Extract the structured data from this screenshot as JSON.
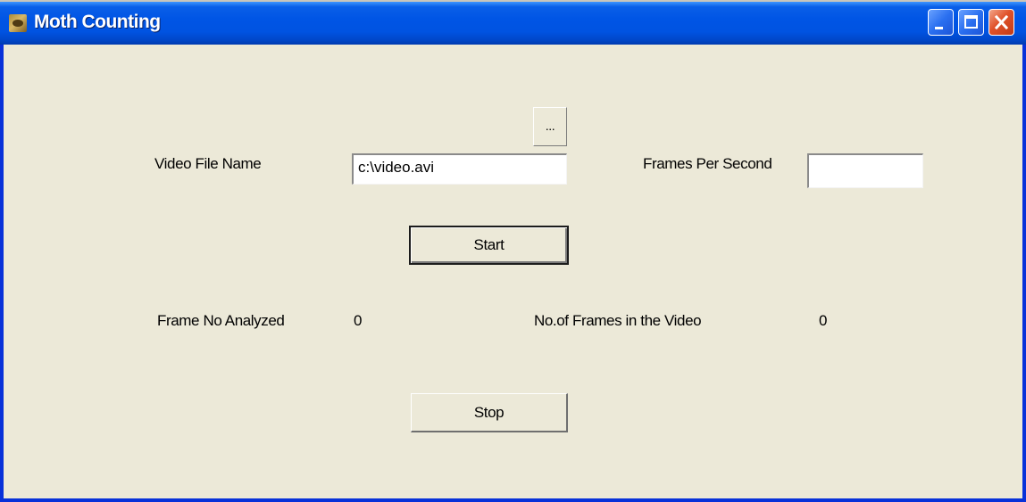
{
  "window": {
    "title": "Moth Counting"
  },
  "titlebar_buttons": {
    "minimize_icon": "minimize-icon",
    "maximize_icon": "maximize-icon",
    "close_icon": "close-icon"
  },
  "form": {
    "video_file_label": "Video File Name",
    "video_file_value": "c:\\video.avi",
    "browse_button_label": "...",
    "fps_label": "Frames Per Second",
    "fps_value": "",
    "start_button_label": "Start",
    "frame_analyzed_label": "Frame No Analyzed",
    "frame_analyzed_value": "0",
    "frames_in_video_label": "No.of Frames in the Video",
    "frames_in_video_value": "0",
    "stop_button_label": "Stop"
  },
  "colors": {
    "titlebar_blue": "#0055e5",
    "window_face": "#ece9d8",
    "close_red": "#e0522a"
  }
}
